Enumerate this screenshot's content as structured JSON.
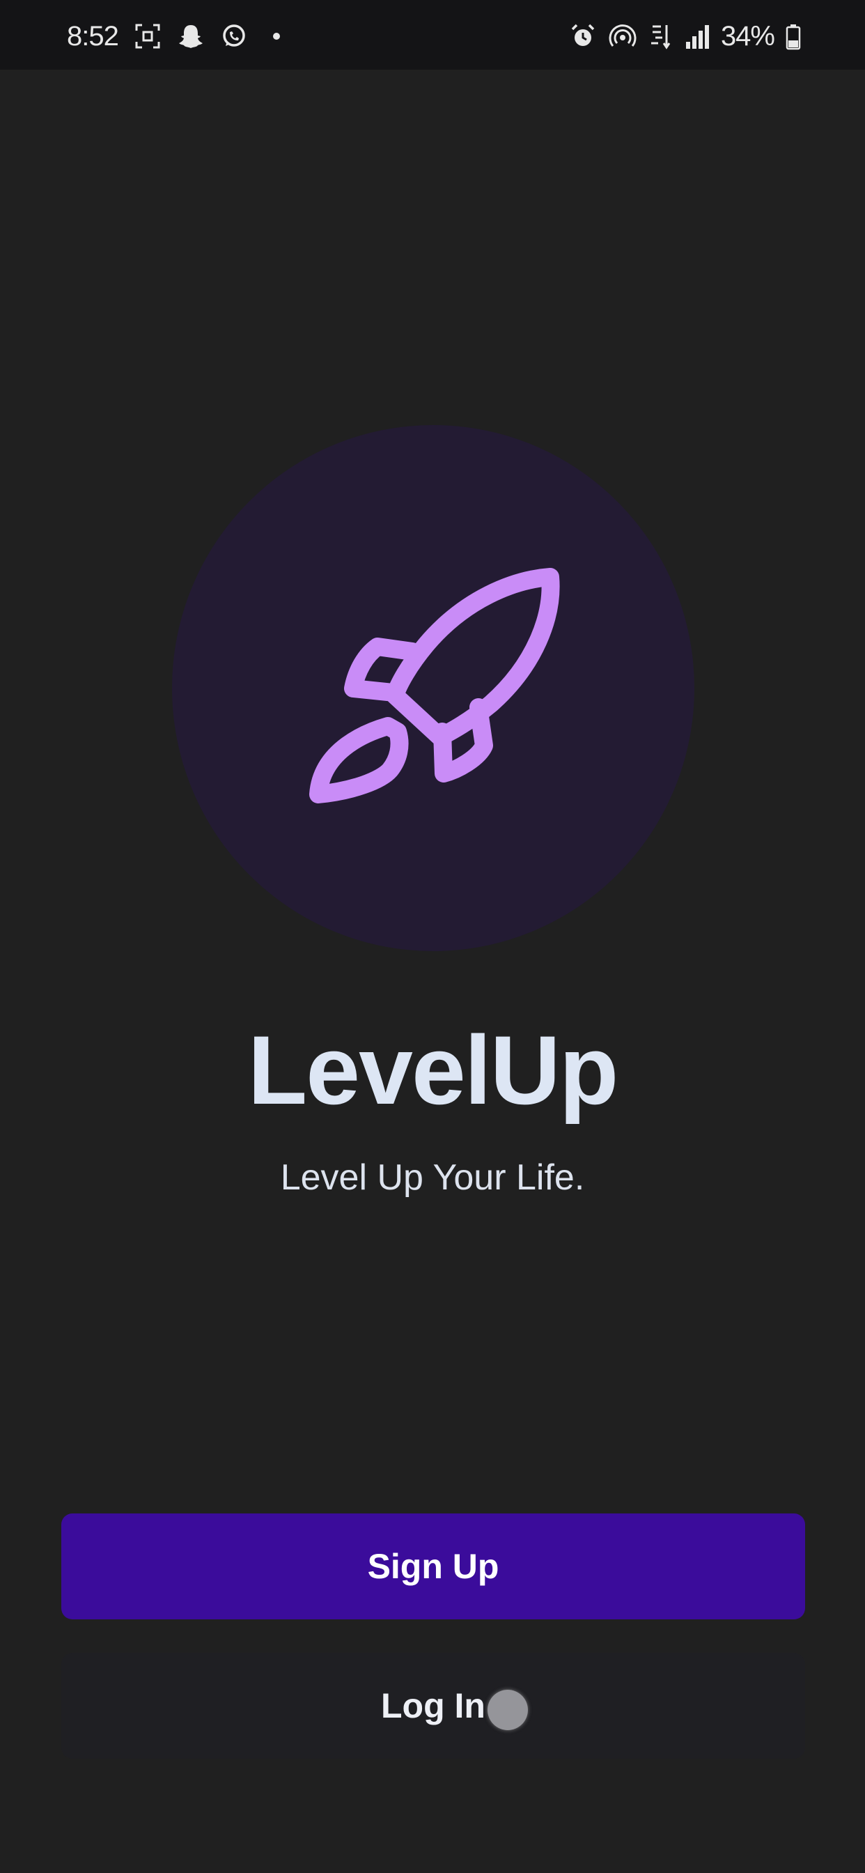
{
  "status_bar": {
    "time": "8:52",
    "battery": "34%",
    "left_icons": [
      "screenshot-icon",
      "snapchat-icon",
      "whatsapp-icon",
      "notification-dot"
    ],
    "right_icons": [
      "alarm-icon",
      "hotspot-icon",
      "wifi-calling-icon",
      "signal-icon",
      "battery-icon"
    ]
  },
  "app": {
    "title": "LevelUp",
    "tagline": "Level Up Your Life.",
    "logo_icon": "rocket-icon"
  },
  "buttons": {
    "signup_label": "Sign Up",
    "login_label": "Log In"
  },
  "colors": {
    "background": "#202020",
    "logo_circle": "#231b33",
    "rocket": "#c98cf7",
    "signup_button": "#3b0c9b",
    "login_button": "#1f1f23",
    "title": "#dde6f4"
  }
}
